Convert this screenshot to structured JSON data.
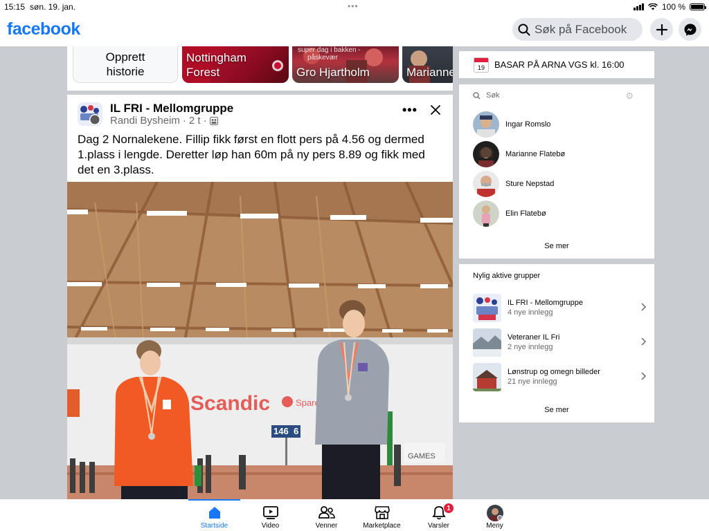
{
  "status_bar": {
    "time": "15:15",
    "date": "søn. 19. jan.",
    "battery": "100 %"
  },
  "header": {
    "logo": "facebook",
    "search_placeholder": "Søk på Facebook",
    "brand_color": "#1877f2"
  },
  "stories": {
    "create_label_line1": "Opprett",
    "create_label_line2": "historie",
    "items": [
      {
        "label_line1": "Nottingham",
        "label_line2": "Forest"
      },
      {
        "label": "Gro Hjartholm",
        "caption_line1": "super dag i bakken -",
        "caption_line2": "påskevær"
      },
      {
        "label": "Marianne"
      }
    ]
  },
  "post": {
    "group_name": "IL FRI - Mellomgruppe",
    "author": "Randi Bysheim",
    "time": "2 t",
    "text": "Dag 2 Nornalekene. Fillip fikk først en flott pers på 4.56 og dermed 1.plass i lengde. Deretter løp han 60m på ny pers 8.89 og fikk med det en 3.plass.",
    "photo": {
      "banner_text": "Scandic",
      "sponsor_text": "Spare",
      "scoreboard": "146",
      "scoreboard_right": "6",
      "games_text": "GAMES"
    }
  },
  "event": {
    "day": "19",
    "title": "BASAR PÅ ARNA VGS",
    "time": "kl. 16:00"
  },
  "contacts": {
    "search_placeholder": "Søk",
    "items": [
      {
        "name": "Ingar Romslo"
      },
      {
        "name": "Marianne Flatebø"
      },
      {
        "name": "Sture Nepstad"
      },
      {
        "name": "Elin Flatebø"
      }
    ],
    "see_more": "Se mer"
  },
  "groups": {
    "title": "Nylig aktive grupper",
    "items": [
      {
        "name": "IL FRI - Mellomgruppe",
        "sub": "4 nye innlegg"
      },
      {
        "name": "Veteraner IL Fri",
        "sub": "2 nye innlegg"
      },
      {
        "name": "Lønstrup og omegn billeder",
        "sub": "21 nye innlegg"
      }
    ],
    "see_more": "Se mer"
  },
  "bottom_nav": {
    "items": [
      {
        "label": "Startside"
      },
      {
        "label": "Video"
      },
      {
        "label": "Venner"
      },
      {
        "label": "Marketplace"
      },
      {
        "label": "Varsler",
        "badge": "1"
      },
      {
        "label": "Meny"
      }
    ]
  }
}
